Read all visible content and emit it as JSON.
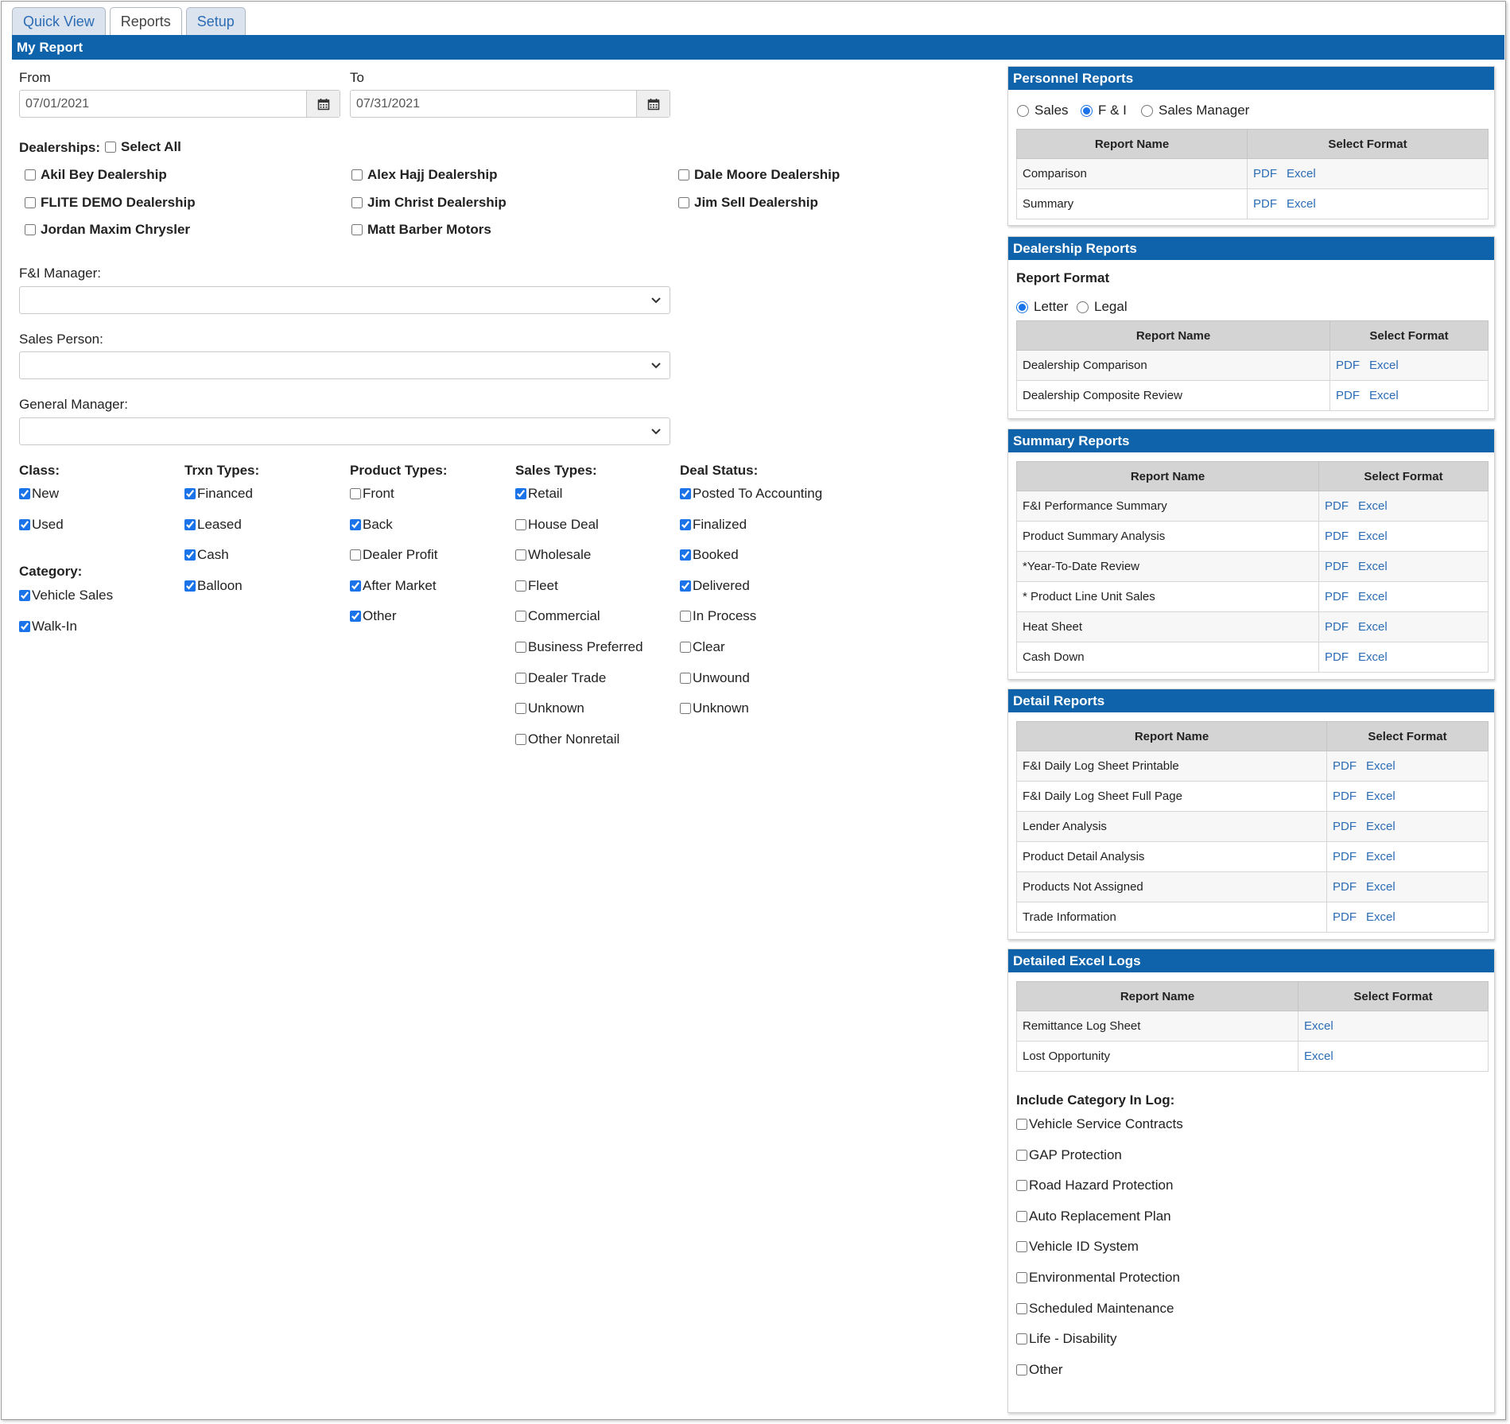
{
  "tabs": [
    "Quick View",
    "Reports",
    "Setup"
  ],
  "active_tab": "Reports",
  "header_title": "My Report",
  "from": {
    "label": "From",
    "value": "07/01/2021"
  },
  "to": {
    "label": "To",
    "value": "07/31/2021"
  },
  "dealerships": {
    "label": "Dealerships:",
    "select_all": "Select All",
    "items": [
      "Akil Bey Dealership",
      "Alex Hajj Dealership",
      "Dale Moore Dealership",
      "FLITE DEMO Dealership",
      "Jim Christ Dealership",
      "Jim Sell Dealership",
      "Jordan Maxim Chrysler",
      "Matt Barber Motors"
    ]
  },
  "fi_manager_label": "F&I Manager:",
  "sales_person_label": "Sales Person:",
  "general_manager_label": "General Manager:",
  "class": {
    "label": "Class:",
    "items": [
      {
        "name": "New",
        "checked": true
      },
      {
        "name": "Used",
        "checked": true
      }
    ]
  },
  "category": {
    "label": "Category:",
    "items": [
      {
        "name": "Vehicle Sales",
        "checked": true
      },
      {
        "name": "Walk-In",
        "checked": true
      }
    ]
  },
  "trxn_types": {
    "label": "Trxn Types:",
    "items": [
      {
        "name": "Financed",
        "checked": true
      },
      {
        "name": "Leased",
        "checked": true
      },
      {
        "name": "Cash",
        "checked": true
      },
      {
        "name": "Balloon",
        "checked": true
      }
    ]
  },
  "product_types": {
    "label": "Product Types:",
    "items": [
      {
        "name": "Front",
        "checked": false
      },
      {
        "name": "Back",
        "checked": true
      },
      {
        "name": "Dealer Profit",
        "checked": false
      },
      {
        "name": "After Market",
        "checked": true
      },
      {
        "name": "Other",
        "checked": true
      }
    ]
  },
  "sales_types": {
    "label": "Sales Types:",
    "items": [
      {
        "name": "Retail",
        "checked": true
      },
      {
        "name": "House Deal",
        "checked": false
      },
      {
        "name": "Wholesale",
        "checked": false
      },
      {
        "name": "Fleet",
        "checked": false
      },
      {
        "name": "Commercial",
        "checked": false
      },
      {
        "name": "Business Preferred",
        "checked": false
      },
      {
        "name": "Dealer Trade",
        "checked": false
      },
      {
        "name": "Unknown",
        "checked": false
      },
      {
        "name": "Other Nonretail",
        "checked": false
      }
    ]
  },
  "deal_status": {
    "label": "Deal Status:",
    "items": [
      {
        "name": "Posted To Accounting",
        "checked": true
      },
      {
        "name": "Finalized",
        "checked": true
      },
      {
        "name": "Booked",
        "checked": true
      },
      {
        "name": "Delivered",
        "checked": true
      },
      {
        "name": "In Process",
        "checked": false
      },
      {
        "name": "Clear",
        "checked": false
      },
      {
        "name": "Unwound",
        "checked": false
      },
      {
        "name": "Unknown",
        "checked": false
      }
    ]
  },
  "col_report_name": "Report Name",
  "col_select_format": "Select Format",
  "pdf_label": "PDF",
  "excel_label": "Excel",
  "personnel": {
    "title": "Personnel Reports",
    "options": [
      "Sales",
      "F & I",
      "Sales Manager"
    ],
    "selected": "F & I",
    "rows": [
      "Comparison",
      "Summary"
    ]
  },
  "dealership_reports": {
    "title": "Dealership Reports",
    "format_label": "Report Format",
    "options": [
      "Letter",
      "Legal"
    ],
    "selected": "Letter",
    "rows": [
      "Dealership Comparison",
      "Dealership Composite Review"
    ]
  },
  "summary_reports": {
    "title": "Summary Reports",
    "rows": [
      "F&I Performance Summary",
      "Product Summary Analysis",
      "*Year-To-Date Review",
      "* Product Line Unit Sales",
      "Heat Sheet",
      "Cash Down"
    ]
  },
  "detail_reports": {
    "title": "Detail Reports",
    "rows": [
      "F&I Daily Log Sheet Printable",
      "F&I Daily Log Sheet Full Page",
      "Lender Analysis",
      "Product Detail Analysis",
      "Products Not Assigned",
      "Trade Information"
    ]
  },
  "excel_logs": {
    "title": "Detailed Excel Logs",
    "rows": [
      "Remittance Log Sheet",
      "Lost Opportunity"
    ],
    "include_label": "Include Category In Log:",
    "categories": [
      "Vehicle Service Contracts",
      "GAP Protection",
      "Road Hazard Protection",
      "Auto Replacement Plan",
      "Vehicle ID System",
      "Environmental Protection",
      "Scheduled Maintenance",
      "Life - Disability",
      "Other"
    ]
  },
  "colors": {
    "header_blue": "#0f63aa",
    "link_blue": "#2b6cb5",
    "table_header": "#d4d4d4"
  }
}
